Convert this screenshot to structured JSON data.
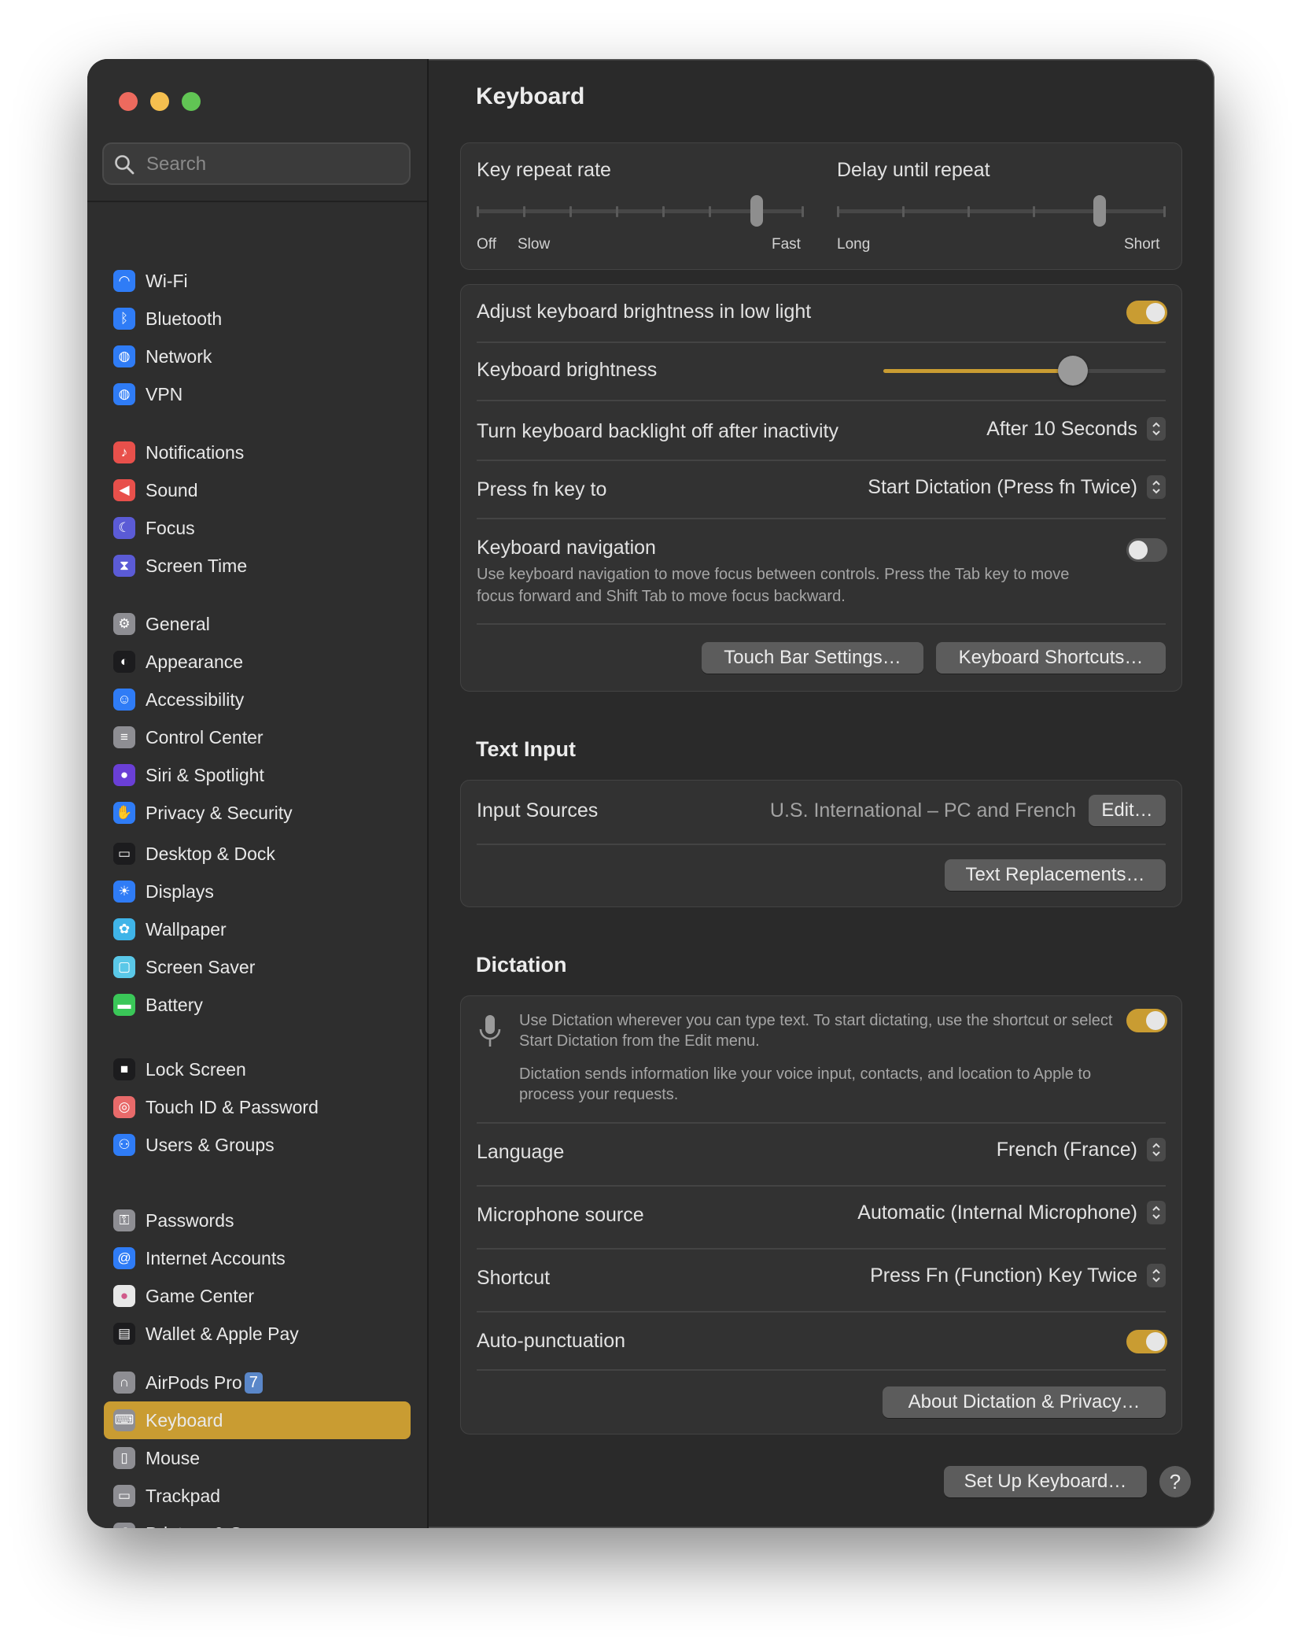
{
  "window": {
    "traffic_lights": [
      "close",
      "minimize",
      "zoom"
    ]
  },
  "search": {
    "placeholder": "Search",
    "value": ""
  },
  "sidebar": {
    "items": [
      {
        "label": "Wi-Fi",
        "icon": "wifi-icon",
        "color": "#2f7cf6"
      },
      {
        "label": "Bluetooth",
        "icon": "bluetooth-icon",
        "color": "#2f7cf6"
      },
      {
        "label": "Network",
        "icon": "globe-icon",
        "color": "#2f7cf6"
      },
      {
        "label": "VPN",
        "icon": "globe-icon",
        "color": "#2f7cf6"
      },
      {
        "label": "Notifications",
        "icon": "bell-icon",
        "color": "#e8504b"
      },
      {
        "label": "Sound",
        "icon": "speaker-icon",
        "color": "#e8504b"
      },
      {
        "label": "Focus",
        "icon": "moon-icon",
        "color": "#5b5bd6"
      },
      {
        "label": "Screen Time",
        "icon": "hourglass-icon",
        "color": "#5b5bd6"
      },
      {
        "label": "General",
        "icon": "gear-icon",
        "color": "#8e8e93"
      },
      {
        "label": "Appearance",
        "icon": "appearance-icon",
        "color": "#1c1c1e"
      },
      {
        "label": "Accessibility",
        "icon": "accessibility-icon",
        "color": "#2f7cf6"
      },
      {
        "label": "Control Center",
        "icon": "toggles-icon",
        "color": "#8e8e93"
      },
      {
        "label": "Siri & Spotlight",
        "icon": "siri-icon",
        "color": "#6a3fd6"
      },
      {
        "label": "Privacy & Security",
        "icon": "hand-icon",
        "color": "#2f7cf6"
      },
      {
        "label": "Desktop & Dock",
        "icon": "dock-icon",
        "color": "#1c1c1e"
      },
      {
        "label": "Displays",
        "icon": "sun-icon",
        "color": "#2f7cf6"
      },
      {
        "label": "Wallpaper",
        "icon": "flower-icon",
        "color": "#3fb4e8"
      },
      {
        "label": "Screen Saver",
        "icon": "screensaver-icon",
        "color": "#5ac8e8"
      },
      {
        "label": "Battery",
        "icon": "battery-icon",
        "color": "#3ac758"
      },
      {
        "label": "Lock Screen",
        "icon": "lock-icon",
        "color": "#1c1c1e"
      },
      {
        "label": "Touch ID & Password",
        "icon": "fingerprint-icon",
        "color": "#e86a6a"
      },
      {
        "label": "Users & Groups",
        "icon": "users-icon",
        "color": "#2f7cf6"
      },
      {
        "label": "Passwords",
        "icon": "key-icon",
        "color": "#8e8e93"
      },
      {
        "label": "Internet Accounts",
        "icon": "at-icon",
        "color": "#2f7cf6"
      },
      {
        "label": "Game Center",
        "icon": "gamecenter-icon",
        "color": "#e8e8e8"
      },
      {
        "label": "Wallet & Apple Pay",
        "icon": "wallet-icon",
        "color": "#1c1c1e"
      },
      {
        "label": "AirPods Pro",
        "icon": "airpods-icon",
        "color": "#8e8e93",
        "badge": "7"
      },
      {
        "label": "Keyboard",
        "icon": "keyboard-icon",
        "color": "#8e8e93",
        "active": true
      },
      {
        "label": "Mouse",
        "icon": "mouse-icon",
        "color": "#8e8e93"
      },
      {
        "label": "Trackpad",
        "icon": "trackpad-icon",
        "color": "#8e8e93"
      },
      {
        "label": "Printers & Scanners",
        "icon": "printer-icon",
        "color": "#8e8e93"
      }
    ]
  },
  "keyboard": {
    "title": "Keyboard",
    "key_repeat": {
      "label": "Key repeat rate",
      "off": "Off",
      "slow": "Slow",
      "fast": "Fast",
      "steps": 8,
      "value_step": 6
    },
    "delay_repeat": {
      "label": "Delay until repeat",
      "long": "Long",
      "short": "Short",
      "steps": 6,
      "value_step": 4
    },
    "adjust_brightness": {
      "label": "Adjust keyboard brightness in low light",
      "on": true
    },
    "brightness": {
      "label": "Keyboard brightness",
      "value": 0.67
    },
    "backlight_off": {
      "label": "Turn keyboard backlight off after inactivity",
      "value": "After 10 Seconds"
    },
    "fn_key": {
      "label": "Press fn key to",
      "value": "Start Dictation (Press fn Twice)"
    },
    "navigation": {
      "label": "Keyboard navigation",
      "desc": "Use keyboard navigation to move focus between controls. Press the Tab key to move focus forward and Shift Tab to move focus backward.",
      "on": false
    },
    "touch_bar_button": "Touch Bar Settings…",
    "shortcuts_button": "Keyboard Shortcuts…"
  },
  "text_input": {
    "title": "Text Input",
    "input_sources_label": "Input Sources",
    "input_sources_value": "U.S. International – PC and French",
    "edit_button": "Edit…",
    "replacements_button": "Text Replacements…"
  },
  "dictation": {
    "title": "Dictation",
    "desc1": "Use Dictation wherever you can type text. To start dictating, use the shortcut or select Start Dictation from the Edit menu.",
    "desc2": "Dictation sends information like your voice input, contacts, and location to Apple to process your requests.",
    "on": true,
    "language_label": "Language",
    "language_value": "French (France)",
    "mic_label": "Microphone source",
    "mic_value": "Automatic (Internal Microphone)",
    "shortcut_label": "Shortcut",
    "shortcut_value": "Press Fn (Function) Key Twice",
    "autopunct_label": "Auto-punctuation",
    "autopunct_on": true,
    "about_button": "About Dictation & Privacy…"
  },
  "footer": {
    "setup_button": "Set Up Keyboard…",
    "help_button": "?"
  },
  "colors": {
    "accent": "#c99c32",
    "window_bg": "#2a2a2a",
    "sidebar_bg": "#2e2e2e",
    "card_bg": "#323232"
  }
}
